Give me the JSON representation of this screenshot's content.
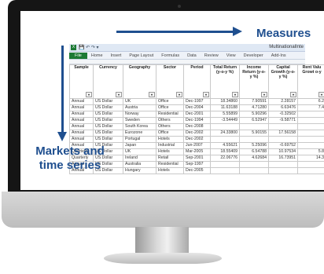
{
  "annotations": {
    "measures": "Measures",
    "markets_line1": "Markets and",
    "markets_line2": "time series"
  },
  "excel": {
    "window_title": "MultinationalInte",
    "ribbon_tabs": [
      "File",
      "Home",
      "Insert",
      "Page Layout",
      "Formulas",
      "Data",
      "Review",
      "View",
      "Developer",
      "Add-Ins"
    ],
    "columns": [
      "Sample",
      "Currency",
      "Geography",
      "Sector",
      "Period",
      "Total Return (y-o-y %)",
      "Income Return (y-o-y %)",
      "Capital Growth (y-o-y %)",
      "Rent Valu Growt o-y"
    ],
    "rows": [
      [
        "Annual",
        "US Dollar",
        "UK",
        "Office",
        "Dec-1997",
        "18.34860",
        "7.90591",
        "2.28157",
        "6.2"
      ],
      [
        "Annual",
        "US Dollar",
        "Austria",
        "Office",
        "Dec-2004",
        "11.63188",
        "4.71280",
        "6.63476",
        "7.4"
      ],
      [
        "Annual",
        "US Dollar",
        "Norway",
        "Residential",
        "Dec-2001",
        "5.55899",
        "5.90296",
        "-0.32502",
        ""
      ],
      [
        "Annual",
        "US Dollar",
        "Sweden",
        "Others",
        "Dec-1994",
        "-3.54449",
        "6.52947",
        "-9.58771",
        ""
      ],
      [
        "Annual",
        "US Dollar",
        "South Korea",
        "Others",
        "Dec-2008",
        "",
        "",
        "",
        ""
      ],
      [
        "Annual",
        "US Dollar",
        "Eurozone",
        "Office",
        "Dec-2002",
        "24.33800",
        "5.90155",
        "17.56158",
        ""
      ],
      [
        "Annual",
        "US Dollar",
        "Portugal",
        "Hotels",
        "Dec-2002",
        "",
        "",
        "",
        ""
      ],
      [
        "Annual",
        "US Dollar",
        "Japan",
        "Industrial",
        "Jun-2007",
        "4.55621",
        "5.25096",
        "-0.69752",
        ""
      ],
      [
        "Quarterly",
        "US Dollar",
        "UK",
        "Hotels",
        "Mar-2005",
        "18.55409",
        "6.54788",
        "10.97534",
        "5.8"
      ],
      [
        "Quarterly",
        "US Dollar",
        "Ireland",
        "Retail",
        "Sep-2001",
        "22.06776",
        "4.62684",
        "16.73951",
        "14.3"
      ],
      [
        "Annual",
        "US Dollar",
        "Australia",
        "Residential",
        "Sep-1997",
        "",
        "",
        "",
        ""
      ],
      [
        "Annual",
        "US Dollar",
        "Hungary",
        "Hotels",
        "Dec-2005",
        "",
        "",
        "",
        ""
      ]
    ]
  }
}
